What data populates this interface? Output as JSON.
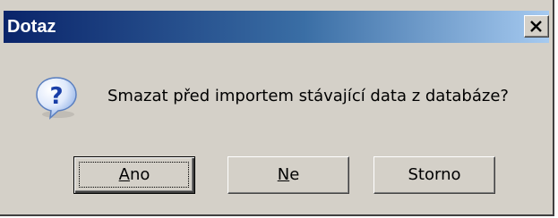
{
  "window": {
    "title": "Dotaz",
    "close_icon": "close-x-icon"
  },
  "message": {
    "icon": "question-icon",
    "text": "Smazat před importem stávající data z databáze?"
  },
  "buttons": {
    "yes": {
      "mnemonic": "A",
      "rest": "no",
      "label": "Ano",
      "default": true
    },
    "no": {
      "mnemonic": "N",
      "rest": "e",
      "label": "Ne"
    },
    "cancel": {
      "label": "Storno"
    }
  },
  "colors": {
    "title_gradient_start": "#0a246a",
    "title_gradient_end": "#a6caf0",
    "dialog_face": "#d4d0c8"
  }
}
